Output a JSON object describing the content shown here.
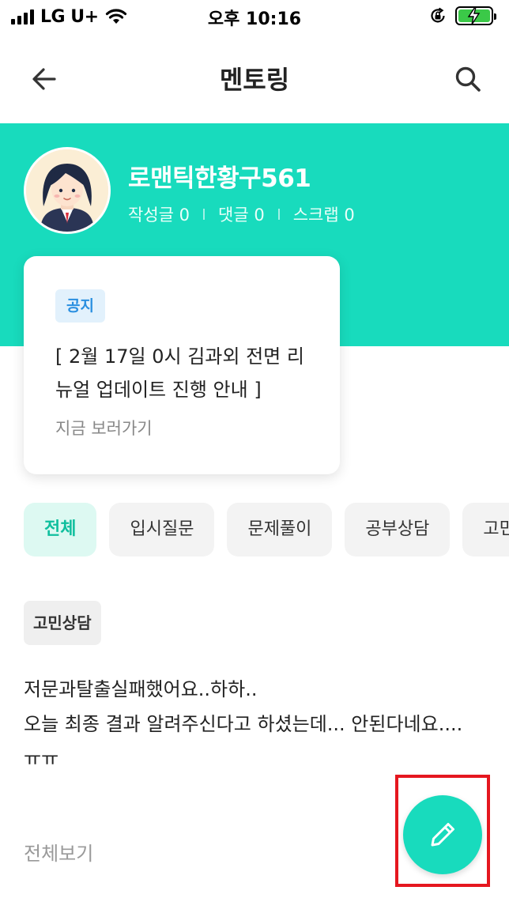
{
  "status_bar": {
    "carrier": "LG U+",
    "time": "오후 10:16"
  },
  "header": {
    "title": "멘토링",
    "back_icon": "arrow-left-icon",
    "search_icon": "search-icon"
  },
  "profile": {
    "name": "로맨틱한황구561",
    "stats": [
      {
        "label": "작성글 0"
      },
      {
        "label": "댓글 0"
      },
      {
        "label": "스크랩 0"
      }
    ]
  },
  "notice": {
    "badge": "공지",
    "text": "[ 2월 17일 0시 김과외 전면 리뉴얼 업데이트 진행 안내 ]",
    "link": "지금 보러가기"
  },
  "categories": [
    {
      "label": "전체",
      "active": true
    },
    {
      "label": "입시질문",
      "active": false
    },
    {
      "label": "문제풀이",
      "active": false
    },
    {
      "label": "공부상담",
      "active": false
    },
    {
      "label": "고민상담",
      "active": false
    }
  ],
  "post": {
    "tag": "고민상담",
    "line1": "저문과탈출실패했어요..하하..",
    "line2": "오늘 최종 결과 알려주신다고 하셨는데... 안된다네요....",
    "line3": "ㅠㅠ",
    "more": "전체보기"
  },
  "fab": {
    "icon": "pencil-icon"
  },
  "colors": {
    "accent": "#18dbbd",
    "notice_badge_bg": "#e2f1fc",
    "notice_badge_text": "#2a8fe0",
    "highlight": "#e5171f"
  }
}
